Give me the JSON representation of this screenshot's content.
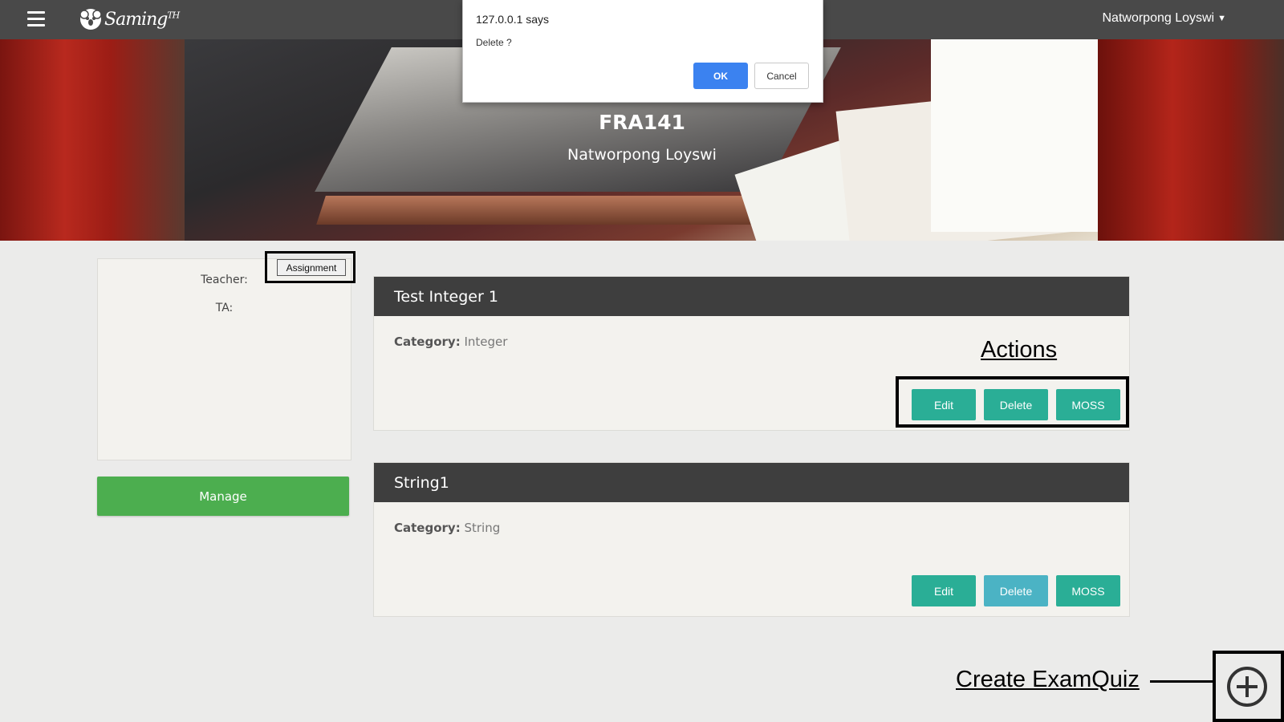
{
  "navbar": {
    "logo_text": "Saming",
    "logo_sup": "TH",
    "user_name": "Natworpong Loyswi"
  },
  "hero": {
    "course_code": "FRA141",
    "owner": "Natworpong Loyswi"
  },
  "dialog": {
    "origin": "127.0.0.1 says",
    "message": "Delete  ?",
    "ok_label": "OK",
    "cancel_label": "Cancel"
  },
  "info": {
    "tag_button": "Assignment",
    "teacher_label": "Teacher:",
    "ta_label": "TA:",
    "manage_label": "Manage"
  },
  "assignments": [
    {
      "title": "Test Integer 1",
      "category_label": "Category:",
      "category": "Integer",
      "edit_label": "Edit",
      "delete_label": "Delete",
      "moss_label": "MOSS"
    },
    {
      "title": "String1",
      "category_label": "Category:",
      "category": "String",
      "edit_label": "Edit",
      "delete_label": "Delete",
      "moss_label": "MOSS"
    }
  ],
  "annotations": {
    "actions": "Actions",
    "create_examquiz": "Create ExamQuiz"
  },
  "colors": {
    "navbar": "#494949",
    "card_header": "#3e3e3e",
    "action_button": "#2aae96",
    "action_button_hover": "#4bb3c4",
    "manage_button": "#4cae4f",
    "dialog_ok": "#3b82f0"
  }
}
